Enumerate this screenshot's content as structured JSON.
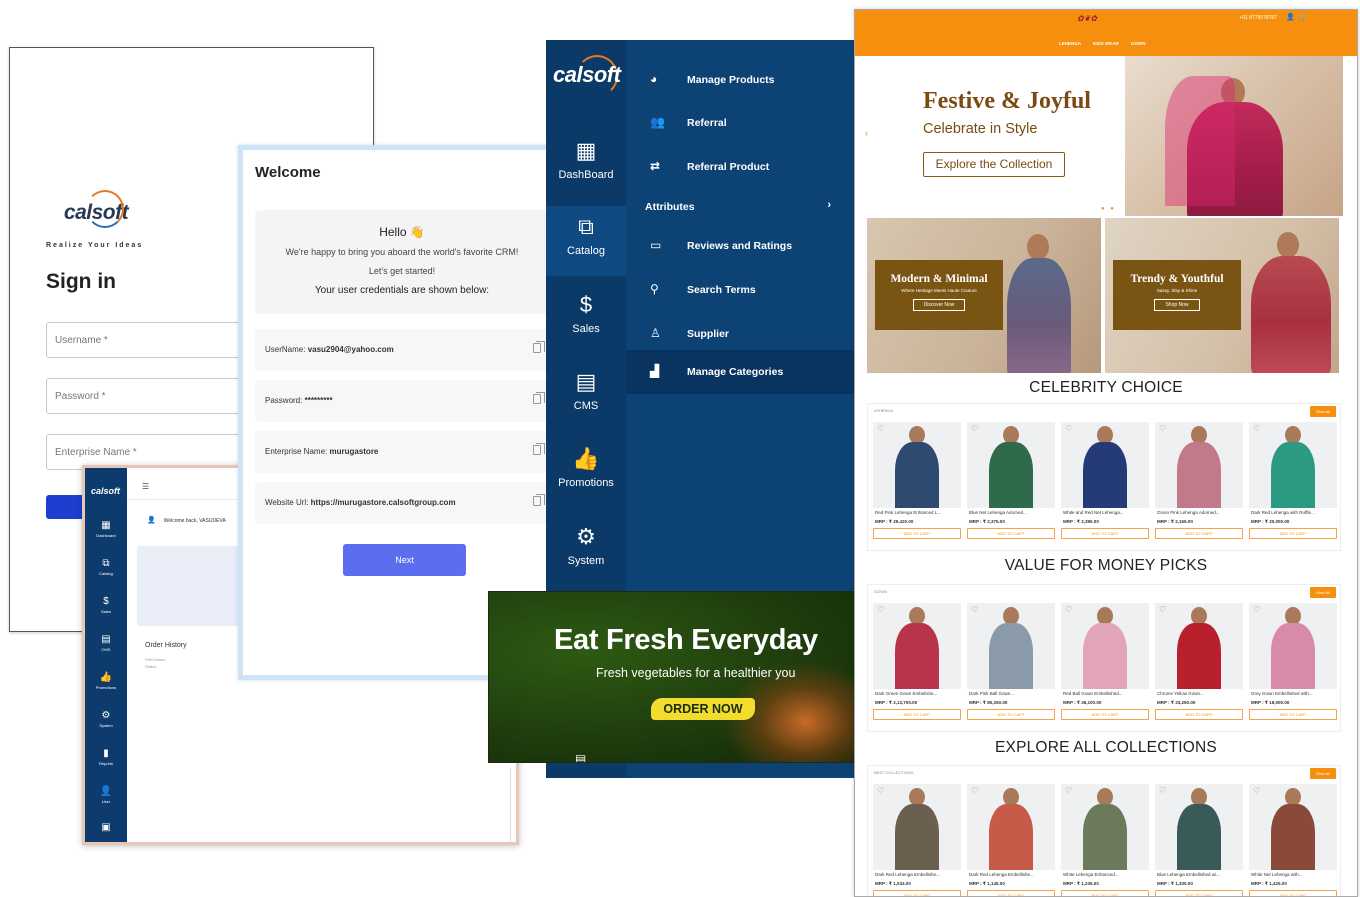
{
  "brand": {
    "name": "calsoft",
    "tagline": "Realize Your Ideas",
    "accent": "#e87722",
    "navy": "#0d4275"
  },
  "signin": {
    "title": "Sign in",
    "username_placeholder": "Username *",
    "password_placeholder": "Password *",
    "enterprise_placeholder": "Enterprise Name *"
  },
  "welcome": {
    "title": "Welcome",
    "close": "×",
    "hello": "Hello 👋",
    "line1": "We're happy to bring you aboard the world's favorite CRM!",
    "line2": "Let's get started!",
    "line3": "Your user credentials are shown below:",
    "credentials": [
      {
        "label": "UserName:",
        "value": "vasu2904@yahoo.com"
      },
      {
        "label": "Password:",
        "value": "*********"
      },
      {
        "label": "Enterprise Name:",
        "value": "murugastore"
      },
      {
        "label": "Website Url:",
        "value": "https://murugastore.calsoftgroup.com"
      }
    ],
    "next_label": "Next"
  },
  "admin": {
    "logo": "calsoft",
    "welcome_back": "Welcome back, VASUDEVA",
    "order_history": "Order History",
    "sub1": "Field Name",
    "sub2": "Status",
    "nav": [
      {
        "label": "Dashboard",
        "icon": "dashboard-icon"
      },
      {
        "label": "Catalog",
        "icon": "catalog-icon"
      },
      {
        "label": "Sales",
        "icon": "dollar-icon"
      },
      {
        "label": "CMS",
        "icon": "cms-icon"
      },
      {
        "label": "Promotions",
        "icon": "thumbs-up-icon"
      },
      {
        "label": "System",
        "icon": "gear-icon"
      },
      {
        "label": "Reports",
        "icon": "bar-chart-icon"
      },
      {
        "label": "User",
        "icon": "user-icon"
      },
      {
        "label": "",
        "icon": "grid-icon"
      }
    ]
  },
  "menu": {
    "logo": "calsoft",
    "rail": [
      {
        "label": "DashBoard",
        "icon": "dashboard-icon"
      },
      {
        "label": "Catalog",
        "icon": "catalog-icon"
      },
      {
        "label": "Sales",
        "icon": "dollar-icon"
      },
      {
        "label": "CMS",
        "icon": "cms-icon"
      },
      {
        "label": "Promotions",
        "icon": "thumbs-up-icon"
      },
      {
        "label": "System",
        "icon": "gear-icon"
      }
    ],
    "items": [
      {
        "label": "Manage Products",
        "icon": "palette-icon"
      },
      {
        "label": "Referral",
        "icon": "people-icon"
      },
      {
        "label": "Referral Product",
        "icon": "share-icon"
      },
      {
        "label": "Attributes",
        "icon": ""
      },
      {
        "label": "Reviews and Ratings",
        "icon": "star-rating-icon"
      },
      {
        "label": "Search Terms",
        "icon": "search-icon"
      },
      {
        "label": "Supplier",
        "icon": "person-icon"
      },
      {
        "label": "Manage Categories",
        "icon": "categories-icon"
      }
    ]
  },
  "fresh": {
    "title": "Eat Fresh Everyday",
    "subtitle": "Fresh vegetables for a healthier you",
    "cta": "ORDER NOW"
  },
  "shop": {
    "header_color": "#f78f0e",
    "phone": "+91 8778078787",
    "nav": [
      "LEHENGA",
      "KIDS WEAR",
      "GOWN"
    ],
    "hero": {
      "title": "Festive & Joyful",
      "subtitle": "Celebrate in Style",
      "cta": "Explore the Collection"
    },
    "promo": [
      {
        "title": "Modern & Minimal",
        "sub": "Where Heritage Meets Haute Couture",
        "btn": "Discover Now"
      },
      {
        "title": "Trendy & Youthful",
        "sub": "Sassy, Slay & Shine",
        "btn": "Shop Now"
      }
    ],
    "sections": [
      {
        "title": "CELEBRITY CHOICE",
        "category": "LEHENGA",
        "view_all": "View All",
        "products": [
          {
            "name": "Red Pink Lehenga Enhanced L...",
            "price": "MRP : ₹ 29,420.00",
            "color": "#2e4a6e"
          },
          {
            "name": "Blue Net Lehenga Adorned...",
            "price": "MRP : ₹ 2,375.00",
            "color": "#2f6b4a"
          },
          {
            "name": "White and Red Net Lehenga...",
            "price": "MRP : ₹ 2,390.00",
            "color": "#243b78"
          },
          {
            "name": "Onion Pink Lehenga Adorned...",
            "price": "MRP : ₹ 2,165.00",
            "color": "#c07a8a"
          },
          {
            "name": "Dark Red Lehenga with Ruffle...",
            "price": "MRP : ₹ 20,000.00",
            "color": "#2c9a82"
          }
        ]
      },
      {
        "title": "VALUE FOR MONEY PICKS",
        "category": "GOWN",
        "view_all": "View All",
        "products": [
          {
            "name": "Dark Green Gown Embelishe...",
            "price": "MRP : ₹ 2,13,700.00",
            "color": "#b8344a"
          },
          {
            "name": "Dark Pink Ball Gown...",
            "price": "MRP : ₹ 80,250.00",
            "color": "#8a9aa8"
          },
          {
            "name": "Red Ball Gown Embellished...",
            "price": "MRP : ₹ 36,100.00",
            "color": "#e2a4b8"
          },
          {
            "name": "Chrome Yellow Gown...",
            "price": "MRP : ₹ 33,250.00",
            "color": "#b8202e"
          },
          {
            "name": "Grey Gown Embellished with...",
            "price": "MRP : ₹ 18,000.00",
            "color": "#d88aa8"
          }
        ]
      },
      {
        "title": "EXPLORE ALL COLLECTIONS",
        "category": "BEST COLLECTIONS",
        "view_all": "View All",
        "products": [
          {
            "name": "Dark Red Lehenga Embellishe...",
            "price": "MRP : ₹ 1,043.00",
            "color": "#6b6050"
          },
          {
            "name": "Dark Red Lehenga Embellishe...",
            "price": "MRP : ₹ 1,145.00",
            "color": "#c85a4a"
          },
          {
            "name": "White Lehenga Enhanced...",
            "price": "MRP : ₹ 1,235.00",
            "color": "#6a7a5a"
          },
          {
            "name": "Blue Lehenga Embellished wi...",
            "price": "MRP : ₹ 1,330.00",
            "color": "#3a5a5a"
          },
          {
            "name": "White Net Lehenga with...",
            "price": "MRP : ₹ 1,425.00",
            "color": "#8a4a3a"
          }
        ]
      }
    ],
    "add_to_cart": "ADD TO CART"
  }
}
